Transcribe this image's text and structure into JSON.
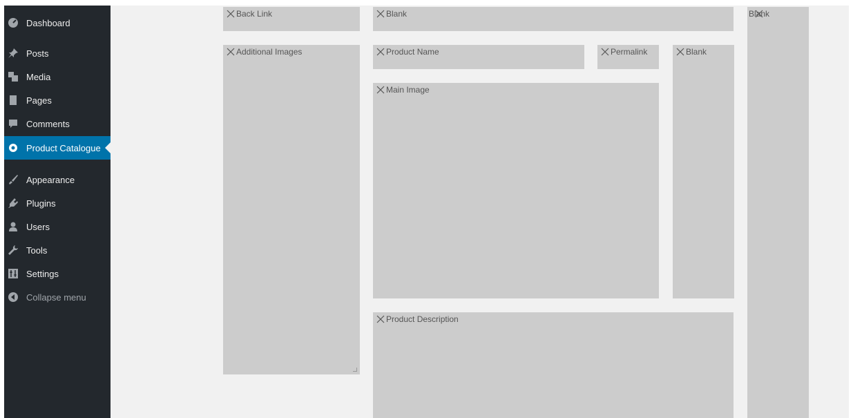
{
  "sidebar": {
    "items": [
      {
        "label": "Dashboard",
        "icon": "dashboard-icon"
      },
      {
        "label": "Posts",
        "icon": "pin-icon"
      },
      {
        "label": "Media",
        "icon": "media-icon"
      },
      {
        "label": "Pages",
        "icon": "pages-icon"
      },
      {
        "label": "Comments",
        "icon": "comment-icon"
      },
      {
        "label": "Product Catalogue",
        "icon": "gear-icon",
        "active": true
      },
      {
        "label": "Appearance",
        "icon": "brush-icon"
      },
      {
        "label": "Plugins",
        "icon": "plug-icon"
      },
      {
        "label": "Users",
        "icon": "user-icon"
      },
      {
        "label": "Tools",
        "icon": "wrench-icon"
      },
      {
        "label": "Settings",
        "icon": "settings-icon"
      },
      {
        "label": "Collapse menu",
        "icon": "collapse-icon"
      }
    ]
  },
  "layout_blocks": [
    {
      "label": "Back Link"
    },
    {
      "label": "Blank"
    },
    {
      "label": "Blank"
    },
    {
      "label": "Additional Images"
    },
    {
      "label": "Product Name"
    },
    {
      "label": "Permalink"
    },
    {
      "label": "Blank"
    },
    {
      "label": "Main Image"
    },
    {
      "label": "Product Description"
    }
  ],
  "colors": {
    "sidebar_bg": "#23282d",
    "active_bg": "#0073aa",
    "content_bg": "#f1f1f1",
    "block_bg": "#cccccc"
  }
}
